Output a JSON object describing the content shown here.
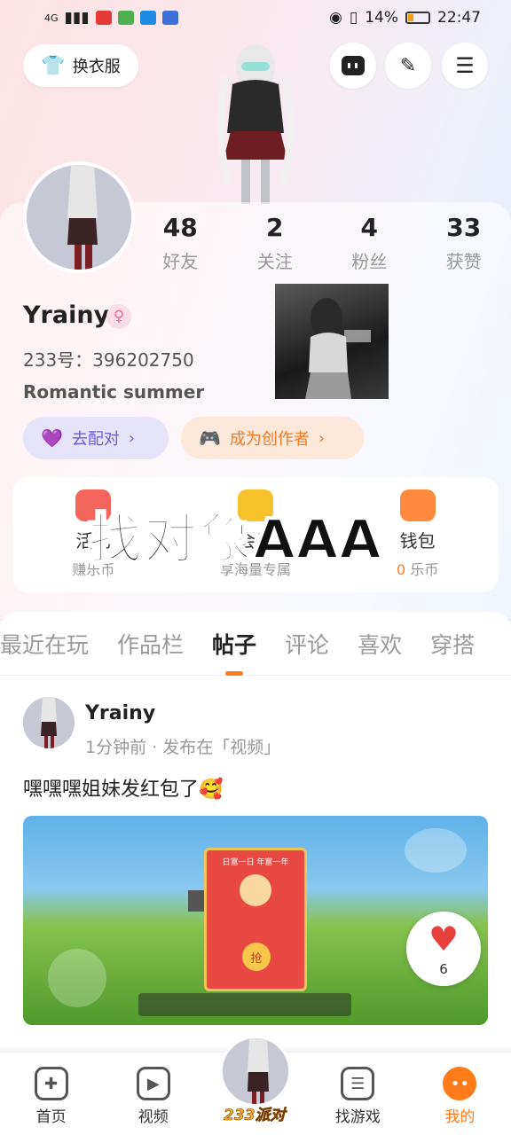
{
  "statusbar": {
    "battery": "14%",
    "time": "22:47",
    "network": "4G"
  },
  "header": {
    "dress_label": "换衣服"
  },
  "stats": [
    {
      "num": "48",
      "label": "好友"
    },
    {
      "num": "2",
      "label": "关注"
    },
    {
      "num": "4",
      "label": "粉丝"
    },
    {
      "num": "33",
      "label": "获赞"
    }
  ],
  "profile": {
    "name": "Yrainy",
    "gender_symbol": "♀",
    "id": "233号：396202750",
    "signature": "Romantic summer"
  },
  "actions": {
    "match": "去配对",
    "creator": "成为创作者"
  },
  "quick": [
    {
      "title": "活动",
      "sub": "赚乐币",
      "color": "#f4665c"
    },
    {
      "title": "会员",
      "sub": "享海量专属",
      "color": "#f6c12a"
    },
    {
      "title": "钱包",
      "sub_num": "0",
      "sub": "乐币",
      "color": "#ff8a3d"
    }
  ],
  "overlay_text": "找对象AAA",
  "tabs": [
    "最近在玩",
    "作品栏",
    "帖子",
    "评论",
    "喜欢",
    "穿搭"
  ],
  "active_tab": "帖子",
  "post": {
    "author": "Yrainy",
    "meta": "1分钟前 · 发布在「视频」",
    "text": "嘿嘿嘿姐妹发红包了🥰",
    "redpack_title": "日富一日  年富一年",
    "redpack_grab": "抢",
    "like_count": "6"
  },
  "bottomnav": [
    {
      "label": "首页",
      "icon": "gamepad-icon"
    },
    {
      "label": "视频",
      "icon": "play-icon"
    },
    {
      "label": "233派对",
      "icon": "party-avatar"
    },
    {
      "label": "找游戏",
      "icon": "list-icon"
    },
    {
      "label": "我的",
      "icon": "face-icon"
    }
  ]
}
